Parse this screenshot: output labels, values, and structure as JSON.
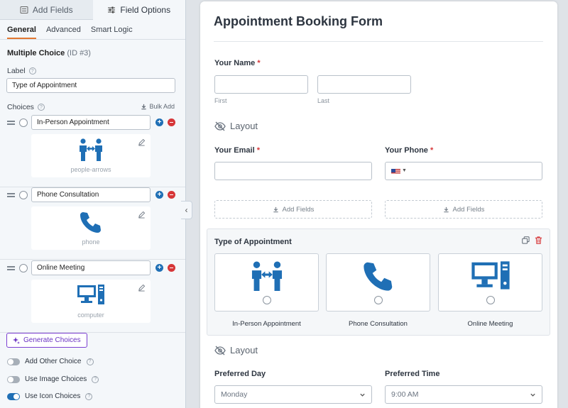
{
  "colors": {
    "accent_orange": "#e27730",
    "icon_blue": "#1f6fb5",
    "remove_red": "#d63638",
    "purple": "#6b34c3"
  },
  "panel": {
    "tabs": [
      {
        "label": "Add Fields",
        "icon": "list-icon"
      },
      {
        "label": "Field Options",
        "icon": "sliders-icon"
      }
    ],
    "subtabs": [
      "General",
      "Advanced",
      "Smart Logic"
    ],
    "field_name": "Multiple Choice",
    "field_id": "(ID #3)",
    "label_caption": "Label",
    "label_value": "Type of Appointment",
    "choices_caption": "Choices",
    "bulk_add": "Bulk Add",
    "choices": [
      {
        "label": "In-Person Appointment",
        "icon": "people-arrows"
      },
      {
        "label": "Phone Consultation",
        "icon": "phone"
      },
      {
        "label": "Online Meeting",
        "icon": "computer"
      }
    ],
    "generate_choices": "Generate Choices",
    "toggles": [
      {
        "label": "Add Other Choice",
        "on": false
      },
      {
        "label": "Use Image Choices",
        "on": false
      },
      {
        "label": "Use Icon Choices",
        "on": true
      }
    ]
  },
  "form": {
    "title": "Appointment Booking Form",
    "name_label": "Your Name",
    "required_mark": "*",
    "first_sub": "First",
    "last_sub": "Last",
    "layout_label": "Layout",
    "email_label": "Your Email",
    "phone_label": "Your Phone",
    "add_fields": "Add Fields",
    "appointment_label": "Type of Appointment",
    "appointment_options": [
      "In-Person Appointment",
      "Phone Consultation",
      "Online Meeting"
    ],
    "preferred_day_label": "Preferred Day",
    "preferred_day_value": "Monday",
    "preferred_time_label": "Preferred Time",
    "preferred_time_value": "9:00 AM"
  }
}
